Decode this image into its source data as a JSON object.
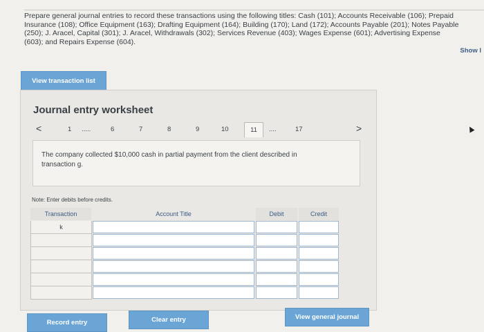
{
  "instructions": "Prepare general journal entries to record these transactions using the following titles: Cash (101); Accounts Receivable (106); Prepaid\nInsurance (108); Office Equipment (163); Drafting Equipment (164); Building (170); Land (172); Accounts Payable (201); Notes Payable\n(250); J. Aracel, Capital (301); J. Aracel, Withdrawals (302); Services Revenue (403); Wages Expense (601); Advertising Expense\n(603); and Repairs Expense (604).",
  "show_link": "Show l",
  "buttons": {
    "view_transaction_list": "View transaction list",
    "record_entry": "Record entry",
    "clear_entry": "Clear entry",
    "view_general_journal": "View general journal"
  },
  "worksheet": {
    "title": "Journal entry worksheet",
    "pager": {
      "prev": "<",
      "next": ">",
      "items": [
        "1",
        ".....",
        "6",
        "7",
        "8",
        "9",
        "10",
        "11",
        "....",
        "17"
      ],
      "active": "11"
    },
    "description": "The company collected $10,000 cash in partial payment from the client described in transaction g.",
    "note": "Note: Enter debits before credits.",
    "table": {
      "headers": {
        "transaction": "Transaction",
        "account_title": "Account Title",
        "debit": "Debit",
        "credit": "Credit"
      },
      "rows": [
        {
          "transaction": "k",
          "account_title": "",
          "debit": "",
          "credit": ""
        },
        {
          "transaction": "",
          "account_title": "",
          "debit": "",
          "credit": ""
        },
        {
          "transaction": "",
          "account_title": "",
          "debit": "",
          "credit": ""
        },
        {
          "transaction": "",
          "account_title": "",
          "debit": "",
          "credit": ""
        },
        {
          "transaction": "",
          "account_title": "",
          "debit": "",
          "credit": ""
        },
        {
          "transaction": "",
          "account_title": "",
          "debit": "",
          "credit": ""
        }
      ]
    }
  },
  "colors": {
    "button": "#6aa5d6",
    "page": "#f1f0ec",
    "header_text": "#3a5b84"
  }
}
